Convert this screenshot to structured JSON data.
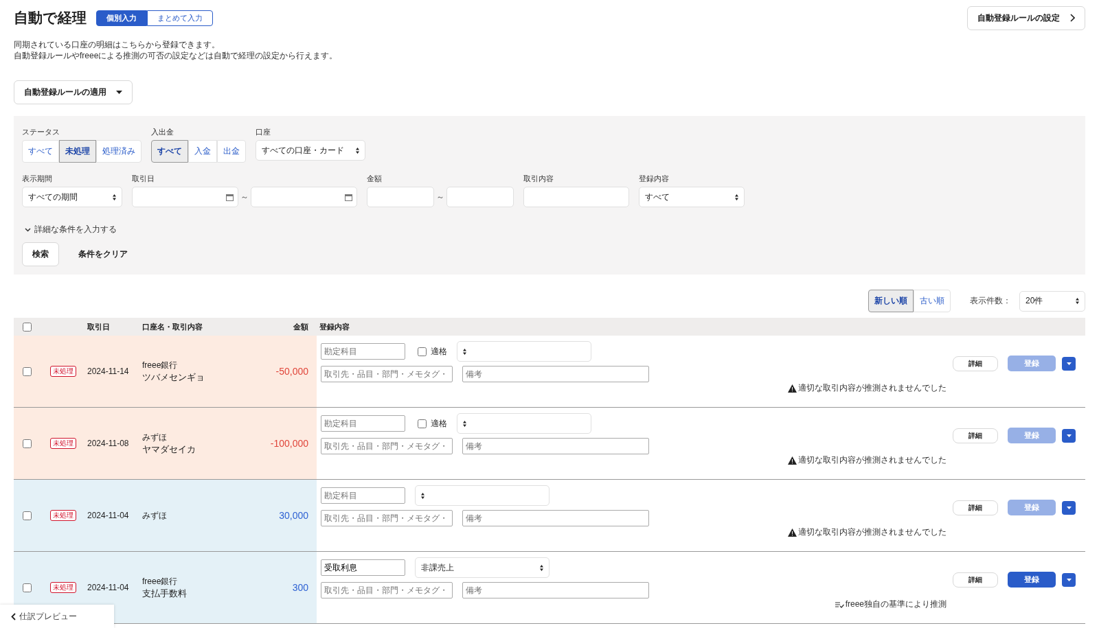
{
  "header": {
    "title": "自動で経理",
    "mode_tabs": [
      {
        "label": "個別入力",
        "selected": true
      },
      {
        "label": "まとめて入力",
        "selected": false
      }
    ],
    "settings_button": "自動登録ルールの設定"
  },
  "description": [
    "同期されている口座の明細はこちらから登録できます。",
    "自動登録ルールやfreeeによる推測の可否の設定などは自動で経理の設定から行えます。"
  ],
  "apply_rules_button": "自動登録ルールの適用",
  "filters": {
    "status": {
      "label": "ステータス",
      "options": [
        {
          "label": "すべて",
          "selected": false
        },
        {
          "label": "未処理",
          "selected": true
        },
        {
          "label": "処理済み",
          "selected": false
        }
      ]
    },
    "direction": {
      "label": "入出金",
      "options": [
        {
          "label": "すべて",
          "selected": true
        },
        {
          "label": "入金",
          "selected": false
        },
        {
          "label": "出金",
          "selected": false
        }
      ]
    },
    "account": {
      "label": "口座",
      "value": "すべての口座・カード"
    },
    "period": {
      "label": "表示期間",
      "value": "すべての期間"
    },
    "date": {
      "label": "取引日",
      "separator": "～"
    },
    "amount": {
      "label": "金額",
      "separator": "～"
    },
    "content": {
      "label": "取引内容"
    },
    "registration": {
      "label": "登録内容",
      "value": "すべて"
    },
    "advanced_toggle": "詳細な条件を入力する",
    "search_button": "検索",
    "clear_button": "条件をクリア"
  },
  "sort": [
    {
      "label": "新しい順",
      "selected": true
    },
    {
      "label": "古い順",
      "selected": false
    }
  ],
  "page_size": {
    "label": "表示件数：",
    "value": "20件"
  },
  "table": {
    "select_all_checked": false,
    "columns": [
      "取引日",
      "口座名・取引内容",
      "金額",
      "登録内容"
    ],
    "rows": [
      {
        "checked": false,
        "status": "未処理",
        "date": "2024-11-14",
        "account": "freee銀行",
        "description": "ツバメセンギョ",
        "amount": "-50,000",
        "kind": "expense",
        "account_placeholder": "勘定科目",
        "qualified": {
          "label": "適格",
          "checked": false
        },
        "partner_placeholder": "取引先・品目・部門・メモタグ・",
        "memo_placeholder": "備考",
        "detail_button": "詳細",
        "register_button": {
          "label": "登録",
          "disabled": true
        },
        "message": {
          "kind": "warning",
          "text": "適切な取引内容が推測されませんでした"
        }
      },
      {
        "checked": false,
        "status": "未処理",
        "date": "2024-11-08",
        "account": "みずほ",
        "description": "ヤマダセイカ",
        "amount": "-100,000",
        "kind": "expense",
        "account_placeholder": "勘定科目",
        "qualified": {
          "label": "適格",
          "checked": false
        },
        "partner_placeholder": "取引先・品目・部門・メモタグ・",
        "memo_placeholder": "備考",
        "detail_button": "詳細",
        "register_button": {
          "label": "登録",
          "disabled": true
        },
        "message": {
          "kind": "warning",
          "text": "適切な取引内容が推測されませんでした"
        }
      },
      {
        "checked": false,
        "status": "未処理",
        "date": "2024-11-04",
        "account": "みずほ",
        "amount": "30,000",
        "kind": "income",
        "account_placeholder": "勘定科目",
        "partner_placeholder": "取引先・品目・部門・メモタグ・",
        "memo_placeholder": "備考",
        "detail_button": "詳細",
        "register_button": {
          "label": "登録",
          "disabled": true
        },
        "message": {
          "kind": "warning",
          "text": "適切な取引内容が推測されませんでした"
        }
      },
      {
        "checked": false,
        "status": "未処理",
        "date": "2024-11-04",
        "account": "freee銀行",
        "description": "支払手数料",
        "amount": "300",
        "kind": "income",
        "account_value": "受取利息",
        "tax_value": "非課売上",
        "partner_placeholder": "取引先・品目・部門・メモタグ・",
        "memo_placeholder": "備考",
        "detail_button": "詳細",
        "register_button": {
          "label": "登録",
          "disabled": false
        },
        "message": {
          "kind": "estimate",
          "text": "freee独自の基準により推測"
        }
      }
    ]
  },
  "preview_tab": "仕訳プレビュー"
}
